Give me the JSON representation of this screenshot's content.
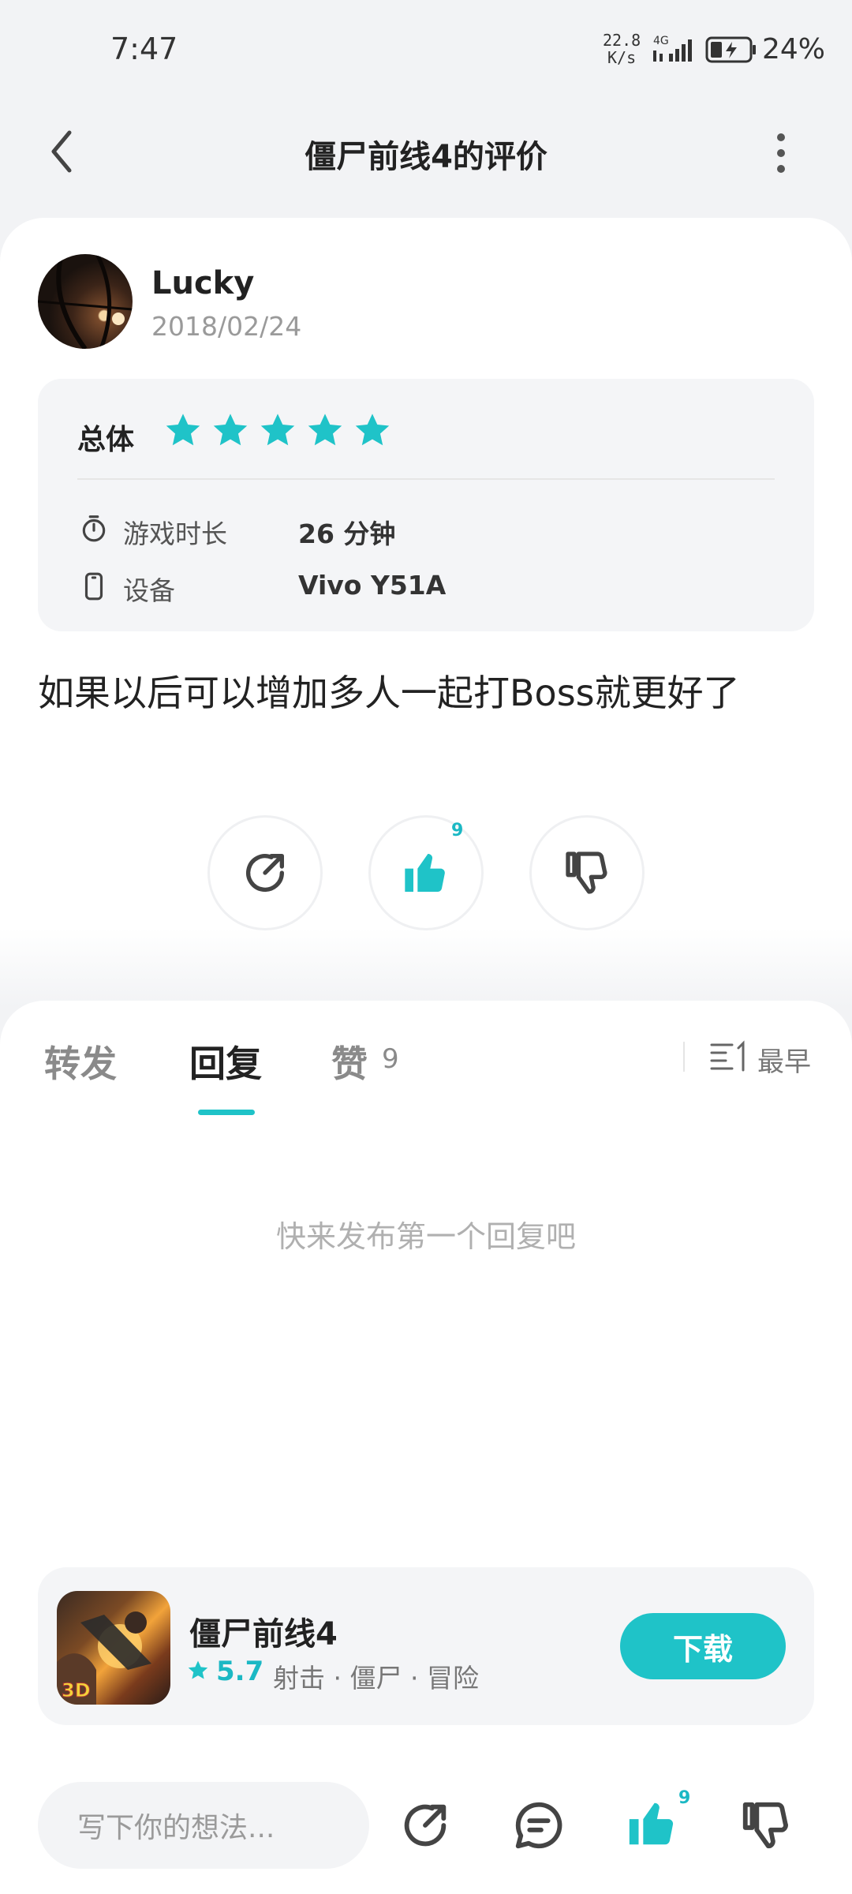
{
  "status_bar": {
    "time": "7:47",
    "net_speed_value": "22.8",
    "net_speed_unit": "K/s",
    "network": "4G",
    "battery": "24%"
  },
  "header": {
    "title": "僵尸前线4的评价",
    "back_icon": "chevron-left-icon",
    "more_icon": "more-vertical-icon"
  },
  "review": {
    "username": "Lucky",
    "date": "2018/02/24",
    "overall_label": "总体",
    "stars": 5,
    "stars_max": 5,
    "play_time_label": "游戏时长",
    "play_time_value": "26 分钟",
    "device_label": "设备",
    "device_value": "Vivo Y51A",
    "text": "如果以后可以增加多人一起打Boss就更好了",
    "like_count": "9"
  },
  "tabs": {
    "items": [
      {
        "label": "转发"
      },
      {
        "label": "回复"
      },
      {
        "label": "赞",
        "count": "9"
      }
    ],
    "active": 1,
    "sort_label": "最早",
    "empty_text": "快来发布第一个回复吧"
  },
  "game": {
    "name": "僵尸前线4",
    "score": "5.7",
    "tags": "射击 · 僵尸 · 冒险",
    "download_label": "下载"
  },
  "bottom_bar": {
    "input_placeholder": "写下你的想法...",
    "like_count": "9"
  },
  "colors": {
    "accent": "#1fc3c8",
    "background": "#f2f3f5"
  }
}
